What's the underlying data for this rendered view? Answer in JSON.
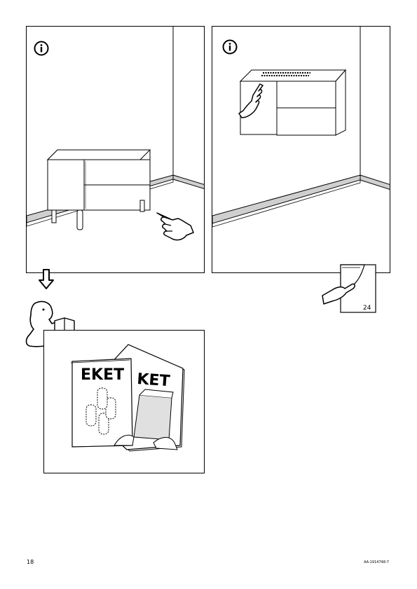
{
  "panels": {
    "floor_furniture": {
      "info_icon": "info-icon",
      "hand_icon": "pointing-hand-icon"
    },
    "wall_furniture": {
      "info_icon": "info-icon",
      "hand_icon": "pointing-hand-icon"
    }
  },
  "page_ref": {
    "number": "24",
    "icon": "page-turn-hand-icon"
  },
  "reading": {
    "arrow_icon": "down-arrow-icon",
    "person_icon": "reading-person-icon",
    "booklet_left_title": "EKET",
    "booklet_right_title": "KET"
  },
  "footer": {
    "page_number": "18",
    "article_code": "AA-1914748-7"
  }
}
